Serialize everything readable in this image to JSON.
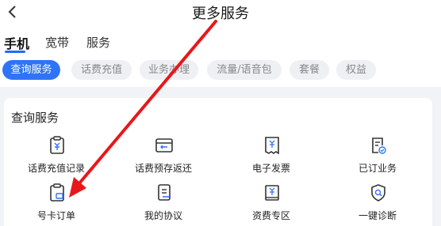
{
  "header": {
    "title": "更多服务",
    "back_icon": "chevron-left-icon"
  },
  "tabs": [
    {
      "label": "手机",
      "active": true
    },
    {
      "label": "宽带",
      "active": false
    },
    {
      "label": "服务",
      "active": false
    }
  ],
  "chips": [
    {
      "label": "查询服务",
      "active": true
    },
    {
      "label": "话费充值",
      "active": false
    },
    {
      "label": "业务办理",
      "active": false
    },
    {
      "label": "流量/语音包",
      "active": false
    },
    {
      "label": "套餐",
      "active": false
    },
    {
      "label": "权益",
      "active": false
    }
  ],
  "section": {
    "title": "查询服务",
    "items": [
      {
        "label": "话费充值记录",
        "icon": "recharge-record-icon"
      },
      {
        "label": "话费预存返还",
        "icon": "prestore-refund-icon"
      },
      {
        "label": "电子发票",
        "icon": "e-invoice-icon"
      },
      {
        "label": "已订业务",
        "icon": "subscribed-services-icon"
      },
      {
        "label": "号卡订单",
        "icon": "sim-card-order-icon"
      },
      {
        "label": "我的协议",
        "icon": "my-agreement-icon"
      },
      {
        "label": "资费专区",
        "icon": "tariff-zone-icon"
      },
      {
        "label": "一键诊断",
        "icon": "one-click-diagnosis-icon"
      }
    ]
  },
  "colors": {
    "accent": "#2f74f6",
    "arrow": "#e8171b",
    "chip_bg": "#eef0f4",
    "page_bg": "#f2f3f6"
  },
  "annotation": {
    "type": "red-arrow",
    "target": "号卡订单"
  }
}
